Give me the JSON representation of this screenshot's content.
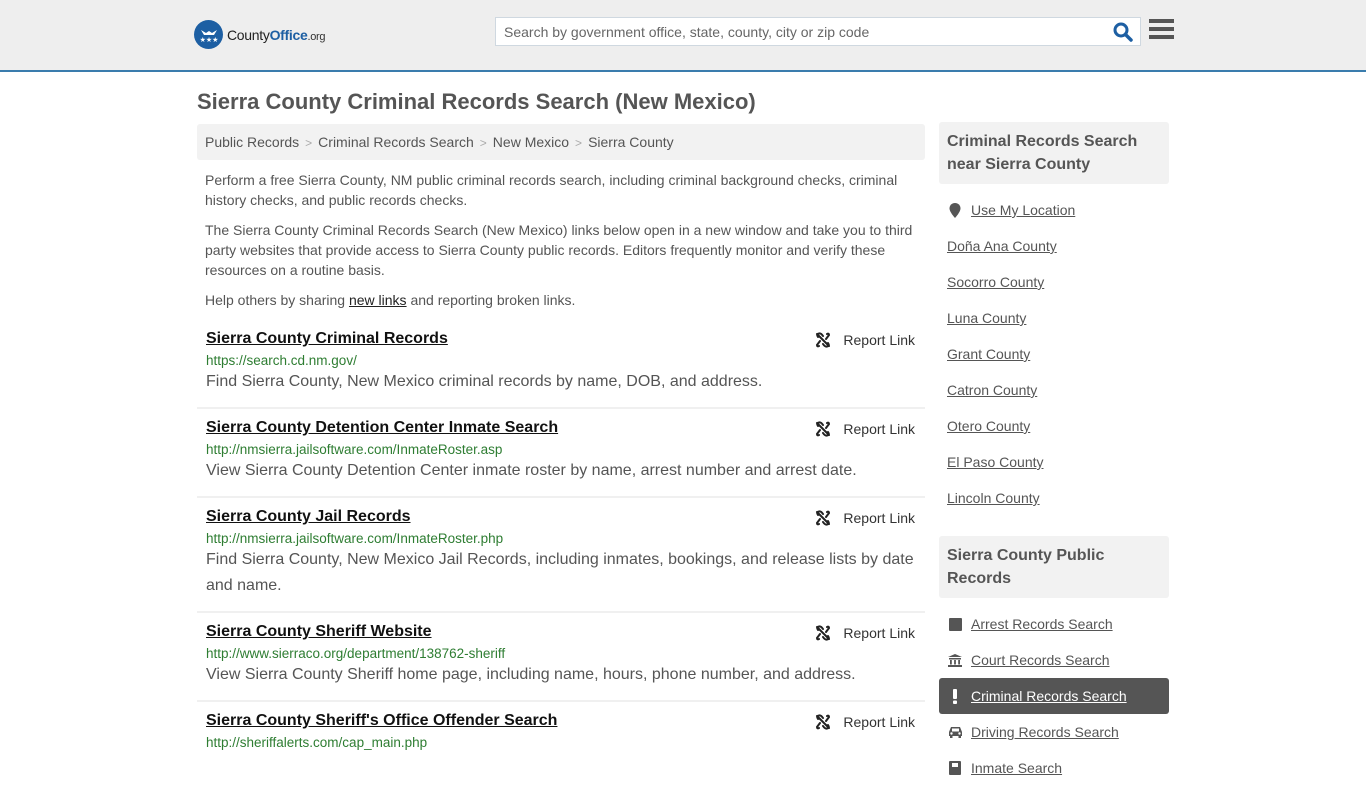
{
  "header": {
    "logo": {
      "part1": "County",
      "part2": "Office",
      "part3": ".org"
    },
    "search": {
      "placeholder": "Search by government office, state, county, city or zip code",
      "value": ""
    }
  },
  "page": {
    "title": "Sierra County Criminal Records Search (New Mexico)",
    "breadcrumb": [
      "Public Records",
      "Criminal Records Search",
      "New Mexico",
      "Sierra County"
    ],
    "intro": {
      "p1": "Perform a free Sierra County, NM public criminal records search, including criminal background checks, criminal history checks, and public records checks.",
      "p2": "The Sierra County Criminal Records Search (New Mexico) links below open in a new window and take you to third party websites that provide access to Sierra County public records. Editors frequently monitor and verify these resources on a routine basis.",
      "p3_before": "Help others by sharing ",
      "p3_link": "new links",
      "p3_after": " and reporting broken links."
    },
    "report_label": "Report Link",
    "results": [
      {
        "title": "Sierra County Criminal Records",
        "url": "https://search.cd.nm.gov/",
        "desc": "Find Sierra County, New Mexico criminal records by name, DOB, and address."
      },
      {
        "title": "Sierra County Detention Center Inmate Search",
        "url": "http://nmsierra.jailsoftware.com/InmateRoster.asp",
        "desc": "View Sierra County Detention Center inmate roster by name, arrest number and arrest date."
      },
      {
        "title": "Sierra County Jail Records",
        "url": "http://nmsierra.jailsoftware.com/InmateRoster.php",
        "desc": "Find Sierra County, New Mexico Jail Records, including inmates, bookings, and release lists by date and name."
      },
      {
        "title": "Sierra County Sheriff Website",
        "url": "http://www.sierraco.org/department/138762-sheriff",
        "desc": "View Sierra County Sheriff home page, including name, hours, phone number, and address."
      },
      {
        "title": "Sierra County Sheriff's Office Offender Search",
        "url": "http://sheriffalerts.com/cap_main.php",
        "desc": ""
      }
    ]
  },
  "sidebar": {
    "nearby": {
      "heading": "Criminal Records Search near Sierra County",
      "use_location": "Use My Location",
      "items": [
        "Doña Ana County",
        "Socorro County",
        "Luna County",
        "Grant County",
        "Catron County",
        "Otero County",
        "El Paso County",
        "Lincoln County"
      ]
    },
    "public_records": {
      "heading": "Sierra County Public Records",
      "items": [
        {
          "label": "Arrest Records Search",
          "icon": "square-icon",
          "active": false
        },
        {
          "label": "Court Records Search",
          "icon": "courthouse-icon",
          "active": false
        },
        {
          "label": "Criminal Records Search",
          "icon": "exclamation-icon",
          "active": true
        },
        {
          "label": "Driving Records Search",
          "icon": "car-icon",
          "active": false
        },
        {
          "label": "Inmate Search",
          "icon": "inmate-icon",
          "active": false
        }
      ]
    }
  },
  "colors": {
    "brand": "#1d5fa3",
    "header_border": "#3a7cad",
    "url_green": "#2e7d32",
    "active_bg": "#555555"
  }
}
